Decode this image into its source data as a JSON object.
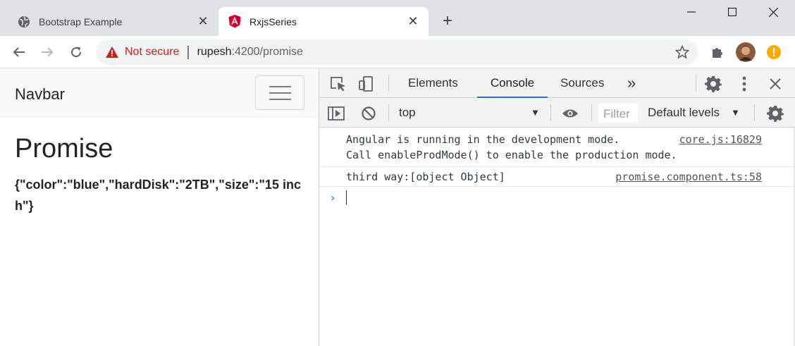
{
  "browser": {
    "tabs": [
      {
        "title": "Bootstrap Example",
        "icon": "globe-icon",
        "active": false
      },
      {
        "title": "RxjsSeries",
        "icon": "angular-logo-icon",
        "active": true
      }
    ],
    "close_glyph": "✕",
    "new_tab_glyph": "+",
    "address": {
      "security_label": "Not secure",
      "host": "rupesh",
      "path": ":4200/promise"
    }
  },
  "page": {
    "navbar_brand": "Navbar",
    "heading": "Promise",
    "json_output": "{\"color\":\"blue\",\"hardDisk\":\"2TB\",\"size\":\"15 inch\"}"
  },
  "devtools": {
    "tabs": [
      "Elements",
      "Console",
      "Sources"
    ],
    "active_tab": "Console",
    "more_tabs_glyph": "»",
    "context": "top",
    "filter_placeholder": "Filter",
    "levels": "Default levels",
    "console": [
      {
        "line1": "Angular is running in the development mode.",
        "line2": "Call enableProdMode() to enable the production mode.",
        "source": "core.js:16829"
      },
      {
        "line1": "third way:[object Object]",
        "source": "promise.component.ts:58"
      }
    ],
    "prompt_glyph": "›"
  },
  "colors": {
    "tabstrip": "#dee1e6",
    "warning_red": "#c5221f",
    "angular_red": "#dd0031",
    "devtools_blue": "#1a73e8",
    "profile_warning": "#f9ab00"
  }
}
